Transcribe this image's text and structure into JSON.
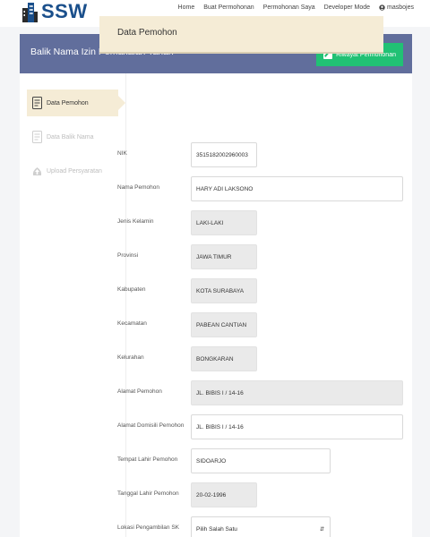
{
  "brand": {
    "name": "SSW"
  },
  "nav": {
    "links": [
      "Home",
      "Buat Permohonan",
      "Permohonan Saya",
      "Developer Mode"
    ],
    "user": "masbojes"
  },
  "header": {
    "title": "Balik Nama Izin Pemakaian Tanah",
    "riwayat_label": "Riwayat Permohonan"
  },
  "steps": [
    {
      "label": "Data Pemohon",
      "active": true
    },
    {
      "label": "Data Balik Nama",
      "active": false
    },
    {
      "label": "Upload Persyaratan",
      "active": false
    }
  ],
  "section": {
    "title": "Data Pemohon"
  },
  "form": [
    {
      "label": "NIK",
      "value": "3515182002960003",
      "readonly": false
    },
    {
      "label": "Nama Pemohon",
      "value": "HARY ADI LAKSONO",
      "readonly": false
    },
    {
      "label": "Jenis Kelamin",
      "value": "LAKI-LAKI",
      "readonly": true
    },
    {
      "label": "Provinsi",
      "value": "JAWA TIMUR",
      "readonly": true
    },
    {
      "label": "Kabupaten",
      "value": "KOTA SURABAYA",
      "readonly": true
    },
    {
      "label": "Kecamatan",
      "value": "PABEAN CANTIAN",
      "readonly": true
    },
    {
      "label": "Kelurahan",
      "value": "BONGKARAN",
      "readonly": true
    },
    {
      "label": "Alamat Pemohon",
      "value": "JL. BIBIS I / 14-16",
      "readonly": true
    },
    {
      "label": "Alamat Domisili Pemohon",
      "value": "JL. BIBIS I / 14-16",
      "readonly": false
    },
    {
      "label": "Tempat Lahir Pemohon",
      "value": "SIDOARJO",
      "readonly": false
    },
    {
      "label": "Tanggal Lahir Pemohon",
      "value": "20-02-1996",
      "readonly": true
    },
    {
      "label": "Lokasi Pengambilan SK",
      "value": "Pilih Salah Satu",
      "readonly": false,
      "select": true
    }
  ],
  "colors": {
    "header_bg": "#616e9c",
    "button_green": "#21c174",
    "step_active_bg": "#f5ecd6",
    "brand_blue": "#1a4f8b"
  },
  "icons": {
    "logo": "building-logo-icon",
    "user": "user-circle-icon",
    "riwayat": "edit-icon",
    "step1": "document-icon",
    "step2": "document-icon",
    "step3": "upload-icon",
    "select": "select-arrows-icon"
  }
}
